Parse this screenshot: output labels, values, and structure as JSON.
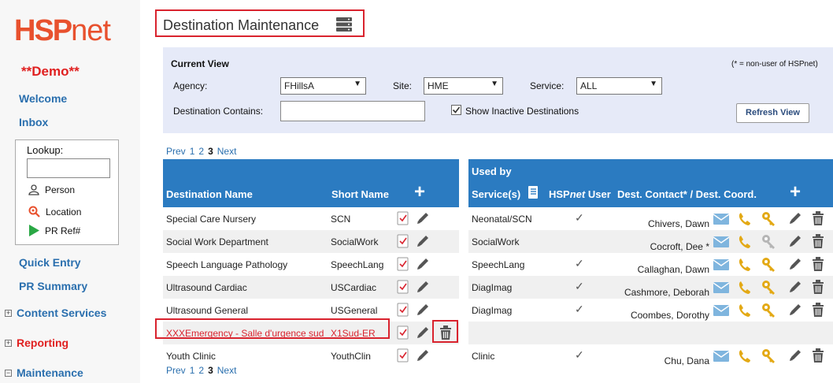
{
  "app": {
    "logo_main": "HSP",
    "logo_suffix": "net",
    "demo_label": "**Demo**"
  },
  "sidebar": {
    "welcome": "Welcome",
    "inbox": "Inbox",
    "lookup": {
      "label": "Lookup:",
      "person": "Person",
      "location": "Location",
      "pr_ref": "PR Ref#"
    },
    "quick_entry": "Quick Entry",
    "pr_summary": "PR Summary",
    "content_services": "Content Services",
    "reporting": "Reporting",
    "maintenance": "Maintenance",
    "expand_symbol": "+",
    "collapse_symbol": "−"
  },
  "page": {
    "title": "Destination Maintenance"
  },
  "current_view": {
    "heading": "Current View",
    "note": "(* = non-user of HSPnet)",
    "agency_label": "Agency:",
    "agency_value": "FHillsA",
    "site_label": "Site:",
    "site_value": "HME",
    "service_label": "Service:",
    "service_value": "ALL",
    "dest_contains_label": "Destination Contains:",
    "dest_contains_value": "",
    "show_inactive_label": "Show Inactive Destinations",
    "show_inactive_checked": true,
    "refresh_label": "Refresh View"
  },
  "pager": {
    "prev": "Prev",
    "pages": [
      "1",
      "2",
      "3"
    ],
    "current": "3",
    "next": "Next"
  },
  "left_table": {
    "col_name": "Destination Name",
    "col_short": "Short Name",
    "add_symbol": "+",
    "rows": [
      {
        "name": "Special Care Nursery",
        "short": "SCN",
        "inactive": false
      },
      {
        "name": "Social Work Department",
        "short": "SocialWork",
        "inactive": false
      },
      {
        "name": "Speech Language Pathology",
        "short": "SpeechLang",
        "inactive": false
      },
      {
        "name": "Ultrasound Cardiac",
        "short": "USCardiac",
        "inactive": false
      },
      {
        "name": "Ultrasound General",
        "short": "USGeneral",
        "inactive": false
      },
      {
        "name": "XXXEmergency - Salle d'urgence sud",
        "short": "X1Sud-ER",
        "inactive": true
      },
      {
        "name": "Youth Clinic",
        "short": "YouthClin",
        "inactive": false
      }
    ]
  },
  "right_table": {
    "col_used_by": "Used by",
    "col_services": "Service(s)",
    "col_user_prefix": "HSP",
    "col_user_em": "net",
    "col_user_suffix": " User",
    "col_contact": "Dest. Contact* / Dest. Coord.",
    "add_symbol": "+",
    "check_symbol": "✓",
    "rows": [
      {
        "service": "Neonatal/SCN",
        "user": true,
        "contact": "Chivers, Dawn",
        "key_active": true
      },
      {
        "service": "SocialWork",
        "user": false,
        "contact": "Cocroft, Dee *",
        "key_active": false
      },
      {
        "service": "SpeechLang",
        "user": true,
        "contact": "Callaghan, Dawn",
        "key_active": true
      },
      {
        "service": "DiagImag",
        "user": true,
        "contact": "Cashmore, Deborah",
        "key_active": true
      },
      {
        "service": "DiagImag",
        "user": true,
        "contact": "Coombes, Dorothy",
        "key_active": true
      },
      {
        "service": "",
        "user": false,
        "contact": "",
        "empty": true
      },
      {
        "service": "Clinic",
        "user": true,
        "contact": "Chu, Dana",
        "key_active": true
      }
    ]
  },
  "colors": {
    "brand": "#e8512e",
    "header_blue": "#2b7bc1",
    "link": "#2a6fae",
    "highlight": "#d9232e",
    "gold": "#e3a915",
    "email": "#7fb5de"
  }
}
